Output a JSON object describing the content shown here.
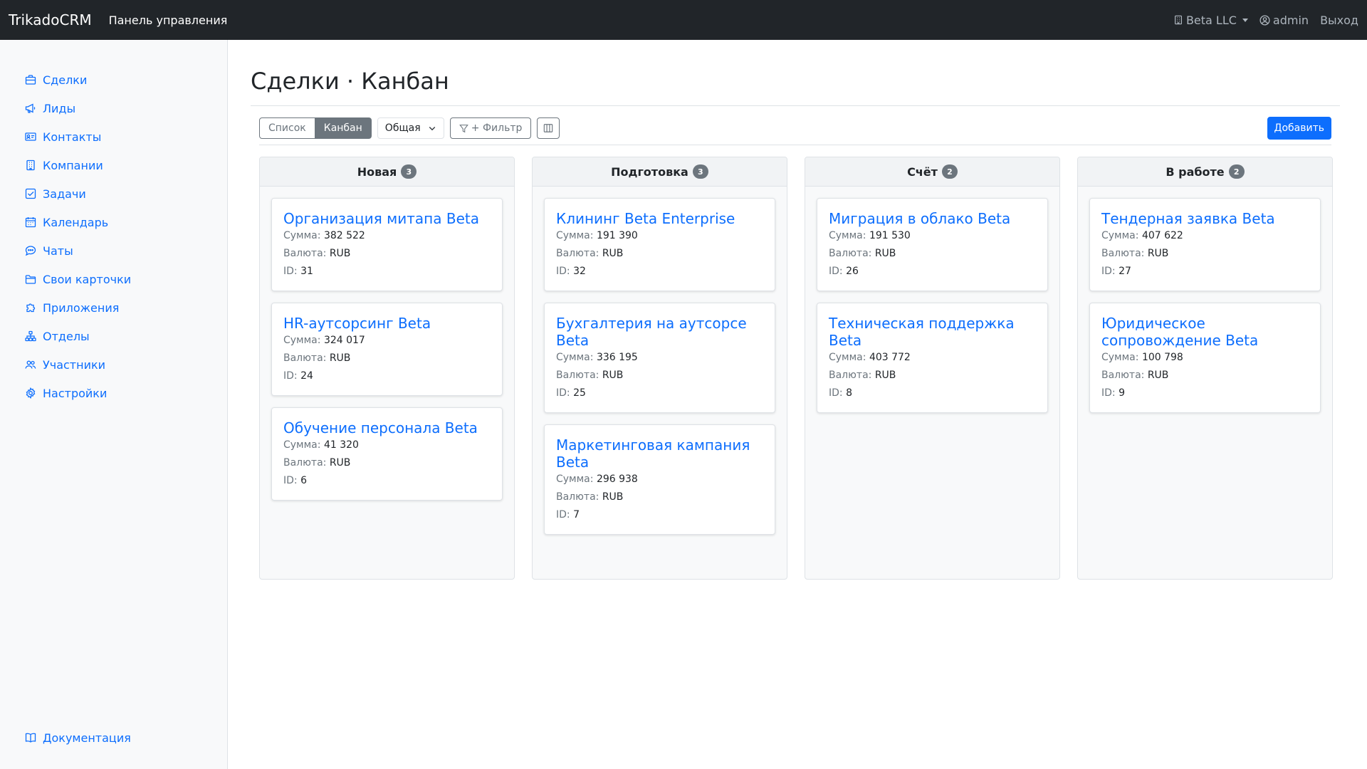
{
  "navbar": {
    "brand": "TrikadoCRM",
    "link": "Панель управления",
    "org": "Beta LLC",
    "user": "admin",
    "logout": "Выход"
  },
  "sidebar": {
    "items": [
      {
        "label": "Сделки",
        "icon": "briefcase-icon"
      },
      {
        "label": "Лиды",
        "icon": "megaphone-icon"
      },
      {
        "label": "Контакты",
        "icon": "person-vcard-icon"
      },
      {
        "label": "Компании",
        "icon": "building-icon"
      },
      {
        "label": "Задачи",
        "icon": "check-square-icon"
      },
      {
        "label": "Календарь",
        "icon": "calendar-icon"
      },
      {
        "label": "Чаты",
        "icon": "chat-icon"
      },
      {
        "label": "Свои карточки",
        "icon": "folder-icon"
      },
      {
        "label": "Приложения",
        "icon": "puzzle-icon"
      },
      {
        "label": "Отделы",
        "icon": "diagram-icon"
      },
      {
        "label": "Участники",
        "icon": "people-icon"
      },
      {
        "label": "Настройки",
        "icon": "gear-icon"
      }
    ],
    "docs": "Документация"
  },
  "page": {
    "title": "Сделки · Канбан"
  },
  "toolbar": {
    "list_label": "Список",
    "kanban_label": "Канбан",
    "view_select": "Общая",
    "filter_label": "+ Фильтр",
    "add_label": "Добавить"
  },
  "labels": {
    "sum": "Сумма:",
    "currency": "Валюта:",
    "id": "ID:"
  },
  "columns": [
    {
      "title": "Новая",
      "count": "3",
      "cards": [
        {
          "title": "Организация митапа Beta",
          "sum": "382 522",
          "currency": "RUB",
          "id": "31"
        },
        {
          "title": "HR-аутсорсинг Beta",
          "sum": "324 017",
          "currency": "RUB",
          "id": "24"
        },
        {
          "title": "Обучение персонала Beta",
          "sum": "41 320",
          "currency": "RUB",
          "id": "6"
        }
      ]
    },
    {
      "title": "Подготовка",
      "count": "3",
      "cards": [
        {
          "title": "Клининг Beta Enterprise",
          "sum": "191 390",
          "currency": "RUB",
          "id": "32"
        },
        {
          "title": "Бухгалтерия на аутсорсе Beta",
          "sum": "336 195",
          "currency": "RUB",
          "id": "25"
        },
        {
          "title": "Маркетинговая кампания Beta",
          "sum": "296 938",
          "currency": "RUB",
          "id": "7"
        }
      ]
    },
    {
      "title": "Счёт",
      "count": "2",
      "cards": [
        {
          "title": "Миграция в облако Beta",
          "sum": "191 530",
          "currency": "RUB",
          "id": "26"
        },
        {
          "title": "Техническая поддержка Beta",
          "sum": "403 772",
          "currency": "RUB",
          "id": "8"
        }
      ]
    },
    {
      "title": "В работе",
      "count": "2",
      "cards": [
        {
          "title": "Тендерная заявка Beta",
          "sum": "407 622",
          "currency": "RUB",
          "id": "27"
        },
        {
          "title": "Юридическое сопровождение Beta",
          "sum": "100 798",
          "currency": "RUB",
          "id": "9"
        }
      ]
    }
  ]
}
